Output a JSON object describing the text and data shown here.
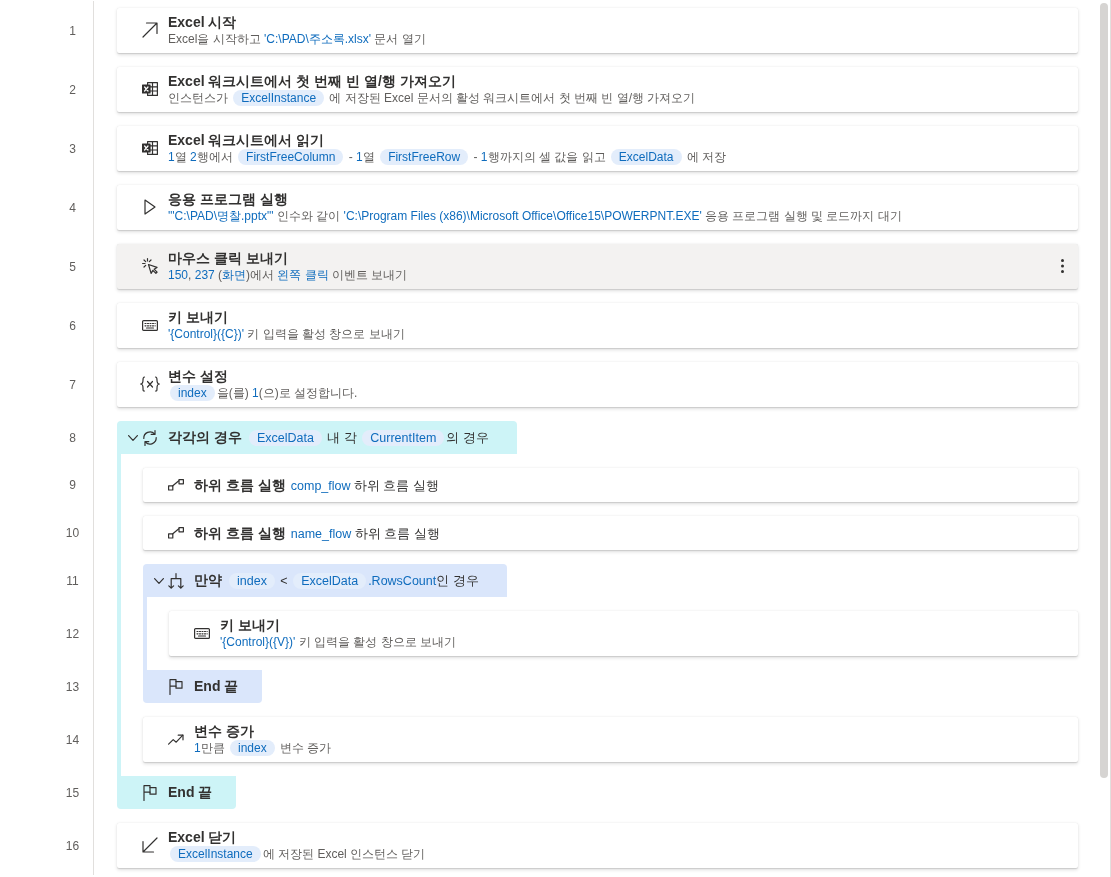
{
  "steps": [
    {
      "number": "1",
      "kind": "launch_excel",
      "title": "Excel 시작",
      "selected": false,
      "description": [
        {
          "kind": "text",
          "text": "Excel을 시작하고 "
        },
        {
          "kind": "value",
          "text": "'C:\\PAD\\주소록.xlsx'"
        },
        {
          "kind": "text",
          "text": " 문서 열기"
        }
      ]
    },
    {
      "number": "2",
      "kind": "excel_sheet",
      "title": "Excel 워크시트에서 첫 번째 빈 열/행 가져오기",
      "selected": false,
      "description": [
        {
          "kind": "text",
          "text": "인스턴스가 "
        },
        {
          "kind": "variable",
          "text": "ExcelInstance"
        },
        {
          "kind": "text",
          "text": " 에 저장된 Excel 문서의 활성 워크시트에서 첫 번째 빈 열/행 가져오기"
        }
      ]
    },
    {
      "number": "3",
      "kind": "excel_sheet",
      "title": "Excel 워크시트에서 읽기",
      "selected": false,
      "description": [
        {
          "kind": "value",
          "text": "1"
        },
        {
          "kind": "text",
          "text": "열 "
        },
        {
          "kind": "value",
          "text": "2"
        },
        {
          "kind": "text",
          "text": "행에서 "
        },
        {
          "kind": "variable",
          "text": "FirstFreeColumn"
        },
        {
          "kind": "text",
          "text": " - "
        },
        {
          "kind": "value",
          "text": "1"
        },
        {
          "kind": "text",
          "text": "열 "
        },
        {
          "kind": "variable",
          "text": "FirstFreeRow"
        },
        {
          "kind": "text",
          "text": " - "
        },
        {
          "kind": "value",
          "text": "1"
        },
        {
          "kind": "text",
          "text": "행까지의 셀 값을 읽고 "
        },
        {
          "kind": "variable",
          "text": "ExcelData"
        },
        {
          "kind": "text",
          "text": " 에 저장"
        }
      ]
    },
    {
      "number": "4",
      "kind": "run_app",
      "title": "응용 프로그램 실행",
      "selected": false,
      "description": [
        {
          "kind": "value",
          "text": "'\"C:\\PAD\\명찰.pptx\"'"
        },
        {
          "kind": "text",
          "text": " 인수와 같이 "
        },
        {
          "kind": "value",
          "text": "'C:\\Program Files (x86)\\Microsoft Office\\Office15\\POWERPNT.EXE'"
        },
        {
          "kind": "text",
          "text": " 응용 프로그램 실행 및 로드까지 대기"
        }
      ]
    },
    {
      "number": "5",
      "kind": "mouse_click",
      "title": "마우스 클릭 보내기",
      "selected": true,
      "description": [
        {
          "kind": "value",
          "text": "150"
        },
        {
          "kind": "text",
          "text": ", "
        },
        {
          "kind": "value",
          "text": "237"
        },
        {
          "kind": "text",
          "text": " ("
        },
        {
          "kind": "value",
          "text": "화면"
        },
        {
          "kind": "text",
          "text": ")에서 "
        },
        {
          "kind": "value",
          "text": "왼쪽 클릭"
        },
        {
          "kind": "text",
          "text": " 이벤트 보내기"
        }
      ]
    },
    {
      "number": "6",
      "kind": "send_keys",
      "title": "키 보내기",
      "selected": false,
      "description": [
        {
          "kind": "value",
          "text": "'{Control}({C})'"
        },
        {
          "kind": "text",
          "text": " 키 입력을 활성 창으로 보내기"
        }
      ]
    },
    {
      "number": "7",
      "kind": "set_variable",
      "title": "변수 설정",
      "selected": false,
      "description": [
        {
          "kind": "variable",
          "text": "index"
        },
        {
          "kind": "text",
          "text": "을(를) "
        },
        {
          "kind": "value",
          "text": "1"
        },
        {
          "kind": "text",
          "text": "(으)로 설정합니다."
        }
      ]
    },
    {
      "number": "8",
      "kind": "loop",
      "title": "각각의 경우",
      "selected": false,
      "expanded": true,
      "description": [
        {
          "kind": "variable",
          "text": "ExcelData"
        },
        {
          "kind": "text",
          "text": " 내 각 "
        },
        {
          "kind": "variable",
          "text": "CurrentItem"
        },
        {
          "kind": "text",
          "text": "의 경우"
        }
      ],
      "children": [
        {
          "number": "9",
          "kind": "run_subflow",
          "title": "하위 흐름 실행",
          "selected": false,
          "description": [
            {
              "kind": "value",
              "text": "comp_flow"
            },
            {
              "kind": "text",
              "text": " 하위 흐름 실행"
            }
          ]
        },
        {
          "number": "10",
          "kind": "run_subflow",
          "title": "하위 흐름 실행",
          "selected": false,
          "description": [
            {
              "kind": "value",
              "text": "name_flow"
            },
            {
              "kind": "text",
              "text": " 하위 흐름 실행"
            }
          ]
        },
        {
          "number": "11",
          "kind": "if",
          "title": "만약",
          "selected": false,
          "expanded": true,
          "description": [
            {
              "kind": "variable",
              "text": "index"
            },
            {
              "kind": "text",
              "text": " < "
            },
            {
              "kind": "variable",
              "text": "ExcelData"
            },
            {
              "kind": "value",
              "text": ".RowsCount"
            },
            {
              "kind": "text",
              "text": "인 경우"
            }
          ],
          "children": [
            {
              "number": "12",
              "kind": "send_keys",
              "title": "키 보내기",
              "selected": false,
              "description": [
                {
                  "kind": "value",
                  "text": "'{Control}({V})'"
                },
                {
                  "kind": "text",
                  "text": " 키 입력을 활성 창으로 보내기"
                }
              ]
            }
          ],
          "end": {
            "number": "13",
            "label": "End 끝"
          }
        },
        {
          "number": "14",
          "kind": "increase_variable",
          "title": "변수 증가",
          "selected": false,
          "description": [
            {
              "kind": "value",
              "text": "1"
            },
            {
              "kind": "text",
              "text": "만큼 "
            },
            {
              "kind": "variable",
              "text": "index"
            },
            {
              "kind": "text",
              "text": " 변수 증가"
            }
          ]
        }
      ],
      "end": {
        "number": "15",
        "label": "End 끝"
      }
    },
    {
      "number": "16",
      "kind": "close_excel",
      "title": "Excel 닫기",
      "selected": false,
      "description": [
        {
          "kind": "variable",
          "text": "ExcelInstance"
        },
        {
          "kind": "text",
          "text": "에 저장된 Excel 인스턴스 닫기"
        }
      ]
    }
  ]
}
